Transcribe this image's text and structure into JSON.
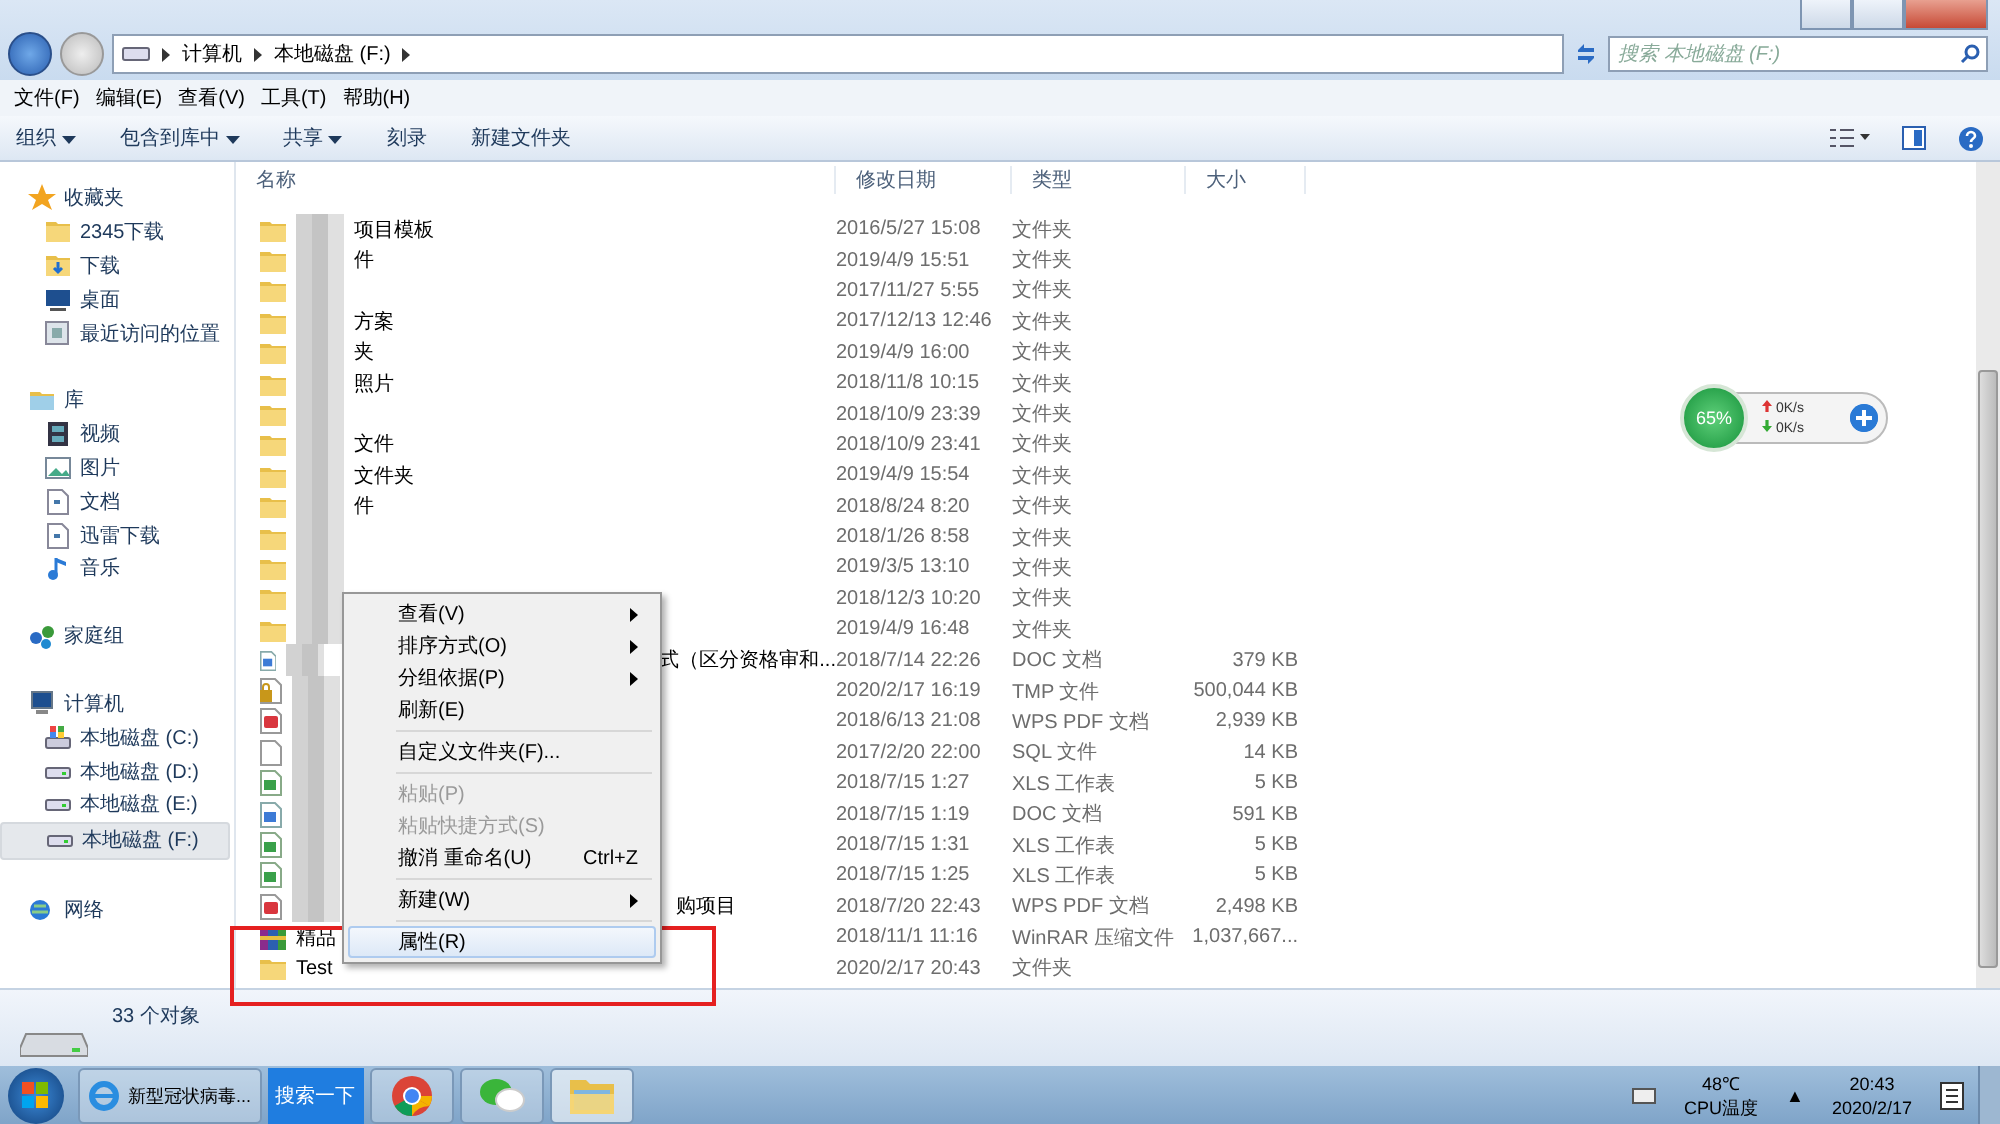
{
  "address": {
    "crumbs": [
      "计算机",
      "本地磁盘 (F:)"
    ]
  },
  "search": {
    "placeholder": "搜索 本地磁盘 (F:)"
  },
  "menubar": [
    "文件(F)",
    "编辑(E)",
    "查看(V)",
    "工具(T)",
    "帮助(H)"
  ],
  "toolbar": [
    {
      "label": "组织",
      "dropdown": true
    },
    {
      "label": "包含到库中",
      "dropdown": true
    },
    {
      "label": "共享",
      "dropdown": true
    },
    {
      "label": "刻录",
      "dropdown": false
    },
    {
      "label": "新建文件夹",
      "dropdown": false
    }
  ],
  "sidebar": {
    "groups": [
      {
        "label": "收藏夹",
        "kind": "star",
        "children": [
          {
            "label": "2345下载",
            "kind": "folder",
            "selected": false
          },
          {
            "label": "下载",
            "kind": "download",
            "selected": false
          },
          {
            "label": "桌面",
            "kind": "desktop",
            "selected": false
          },
          {
            "label": "最近访问的位置",
            "kind": "recent",
            "selected": false
          }
        ]
      },
      {
        "label": "库",
        "kind": "library",
        "children": [
          {
            "label": "视频",
            "kind": "video",
            "selected": false
          },
          {
            "label": "图片",
            "kind": "image",
            "selected": false
          },
          {
            "label": "文档",
            "kind": "doc",
            "selected": false
          },
          {
            "label": "迅雷下载",
            "kind": "doc",
            "selected": false
          },
          {
            "label": "音乐",
            "kind": "music",
            "selected": false
          }
        ]
      },
      {
        "label": "家庭组",
        "kind": "homegroup"
      },
      {
        "label": "计算机",
        "kind": "computer",
        "children": [
          {
            "label": "本地磁盘 (C:)",
            "kind": "sysdrive",
            "selected": false
          },
          {
            "label": "本地磁盘 (D:)",
            "kind": "drive",
            "selected": false
          },
          {
            "label": "本地磁盘 (E:)",
            "kind": "drive",
            "selected": false
          },
          {
            "label": "本地磁盘 (F:)",
            "kind": "drive",
            "selected": true
          }
        ]
      },
      {
        "label": "网络",
        "kind": "network"
      }
    ]
  },
  "table": {
    "columns": [
      "名称",
      "修改日期",
      "类型",
      "大小"
    ],
    "rows": [
      {
        "name": "项目模板",
        "date": "2016/5/27 15:08",
        "type": "文件夹",
        "size": "",
        "kind": "folder",
        "blurred": true
      },
      {
        "name": "件",
        "date": "2019/4/9 15:51",
        "type": "文件夹",
        "size": "",
        "kind": "folder",
        "blurred": true
      },
      {
        "name": "",
        "date": "2017/11/27 5:55",
        "type": "文件夹",
        "size": "",
        "kind": "folder",
        "blurred": true
      },
      {
        "name": "方案",
        "date": "2017/12/13 12:46",
        "type": "文件夹",
        "size": "",
        "kind": "folder",
        "blurred": true
      },
      {
        "name": "夹",
        "date": "2019/4/9 16:00",
        "type": "文件夹",
        "size": "",
        "kind": "folder",
        "blurred": true
      },
      {
        "name": "照片",
        "date": "2018/11/8 10:15",
        "type": "文件夹",
        "size": "",
        "kind": "folder",
        "blurred": true
      },
      {
        "name": "",
        "date": "2018/10/9 23:39",
        "type": "文件夹",
        "size": "",
        "kind": "folder",
        "blurred": true
      },
      {
        "name": "文件",
        "date": "2018/10/9 23:41",
        "type": "文件夹",
        "size": "",
        "kind": "folder",
        "blurred": true
      },
      {
        "name": "文件夹",
        "date": "2019/4/9 15:54",
        "type": "文件夹",
        "size": "",
        "kind": "folder",
        "blurred": true
      },
      {
        "name": "件",
        "date": "2018/8/24 8:20",
        "type": "文件夹",
        "size": "",
        "kind": "folder",
        "blurred": true
      },
      {
        "name": "",
        "date": "2018/1/26 8:58",
        "type": "文件夹",
        "size": "",
        "kind": "folder",
        "blurred": true
      },
      {
        "name": "",
        "date": "2019/3/5 13:10",
        "type": "文件夹",
        "size": "",
        "kind": "folder",
        "blurred": true
      },
      {
        "name": "",
        "date": "2018/12/3 10:20",
        "type": "文件夹",
        "size": "",
        "kind": "folder",
        "blurred": true
      },
      {
        "name": "",
        "date": "2019/4/9 16:48",
        "type": "文件夹",
        "size": "",
        "kind": "folder",
        "blurred": true
      },
      {
        "name": "式（区分资格审和...",
        "date": "2018/7/14 22:26",
        "type": "DOC 文档",
        "size": "379 KB",
        "kind": "doc",
        "blurred": true
      },
      {
        "name": "",
        "date": "2020/2/17 16:19",
        "type": "TMP 文件",
        "size": "500,044 KB",
        "kind": "locked",
        "blurred": true
      },
      {
        "name": "",
        "date": "2018/6/13 21:08",
        "type": "WPS PDF 文档",
        "size": "2,939 KB",
        "kind": "pdf",
        "blurred": true
      },
      {
        "name": "",
        "date": "2017/2/20 22:00",
        "type": "SQL 文件",
        "size": "14 KB",
        "kind": "blank",
        "blurred": true
      },
      {
        "name": "",
        "date": "2018/7/15 1:27",
        "type": "XLS 工作表",
        "size": "5 KB",
        "kind": "xls",
        "blurred": true
      },
      {
        "name": "",
        "date": "2018/7/15 1:19",
        "type": "DOC 文档",
        "size": "591 KB",
        "kind": "doc",
        "blurred": true
      },
      {
        "name": "",
        "date": "2018/7/15 1:31",
        "type": "XLS 工作表",
        "size": "5 KB",
        "kind": "xls",
        "blurred": true
      },
      {
        "name": "",
        "date": "2018/7/15 1:25",
        "type": "XLS 工作表",
        "size": "5 KB",
        "kind": "xls",
        "blurred": true
      },
      {
        "name": "购项目",
        "date": "2018/7/20 22:43",
        "type": "WPS PDF 文档",
        "size": "2,498 KB",
        "kind": "pdf",
        "blurred": true
      },
      {
        "name": "精品",
        "date": "2018/11/1 11:16",
        "type": "WinRAR 压缩文件",
        "size": "1,037,667...",
        "kind": "rar"
      },
      {
        "name": "Test",
        "date": "2020/2/17 20:43",
        "type": "文件夹",
        "size": "",
        "kind": "folder"
      }
    ]
  },
  "context_menu": {
    "items": [
      {
        "kind": "item",
        "label": "查看(V)",
        "submenu": true,
        "disabled": false,
        "selected": false
      },
      {
        "kind": "item",
        "label": "排序方式(O)",
        "submenu": true,
        "disabled": false,
        "selected": false
      },
      {
        "kind": "item",
        "label": "分组依据(P)",
        "submenu": true,
        "disabled": false,
        "selected": false
      },
      {
        "kind": "item",
        "label": "刷新(E)",
        "submenu": false,
        "disabled": false,
        "selected": false
      },
      {
        "kind": "separator"
      },
      {
        "kind": "item",
        "label": "自定义文件夹(F)...",
        "submenu": false,
        "disabled": false,
        "selected": false
      },
      {
        "kind": "separator"
      },
      {
        "kind": "item",
        "label": "粘贴(P)",
        "submenu": false,
        "disabled": true,
        "selected": false
      },
      {
        "kind": "item",
        "label": "粘贴快捷方式(S)",
        "submenu": false,
        "disabled": true,
        "selected": false
      },
      {
        "kind": "item",
        "label": "撤消 重命名(U)",
        "shortcut": "Ctrl+Z",
        "submenu": false,
        "disabled": false,
        "selected": false
      },
      {
        "kind": "separator"
      },
      {
        "kind": "item",
        "label": "新建(W)",
        "submenu": true,
        "disabled": false,
        "selected": false
      },
      {
        "kind": "separator"
      },
      {
        "kind": "item",
        "label": "属性(R)",
        "submenu": false,
        "disabled": false,
        "selected": true
      }
    ]
  },
  "gadget": {
    "percent": "65%",
    "upload": "0K/s",
    "download": "0K/s"
  },
  "status_bar": {
    "count": "33 个对象"
  },
  "taskbar": {
    "items": [
      {
        "kind": "ie",
        "label": "新型冠状病毒..."
      },
      {
        "kind": "searchbtn",
        "label": "搜索一下"
      },
      {
        "kind": "chrome"
      },
      {
        "kind": "wechat"
      },
      {
        "kind": "explorer"
      }
    ],
    "temp": "48℃",
    "temp_label": "CPU温度",
    "tray_arrow": "▲",
    "time": "20:43",
    "date": "2020/2/17"
  }
}
